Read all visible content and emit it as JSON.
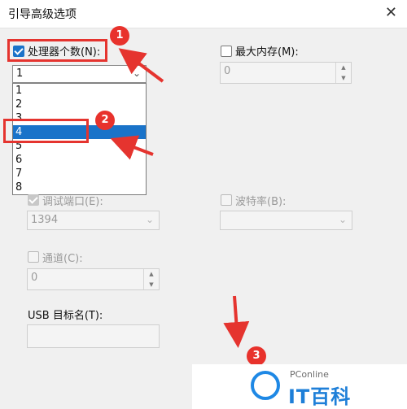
{
  "window": {
    "title": "引导高级选项",
    "close_glyph": "✕"
  },
  "processor_count": {
    "label": "处理器个数(N):",
    "checked": true,
    "selected_value": "1",
    "options": [
      "1",
      "2",
      "3",
      "4",
      "5",
      "6",
      "7",
      "8"
    ],
    "highlighted_option": "4"
  },
  "max_memory": {
    "label": "最大内存(M):",
    "checked": false,
    "value": "0"
  },
  "debug_port": {
    "label": "调试端口(E):",
    "checked": true,
    "value": "1394"
  },
  "baud_rate": {
    "label": "波特率(B):",
    "checked": false,
    "value": ""
  },
  "channel": {
    "label": "通道(C):",
    "checked": false,
    "value": "0"
  },
  "usb_target": {
    "label": "USB 目标名(T):",
    "value": ""
  },
  "annotations": {
    "badge_1": "1",
    "badge_2": "2",
    "badge_3": "3",
    "accent_color": "#e5342f",
    "selection_color": "#1a73c9"
  },
  "watermark": {
    "brand": "PConline",
    "name": "IT百科"
  }
}
